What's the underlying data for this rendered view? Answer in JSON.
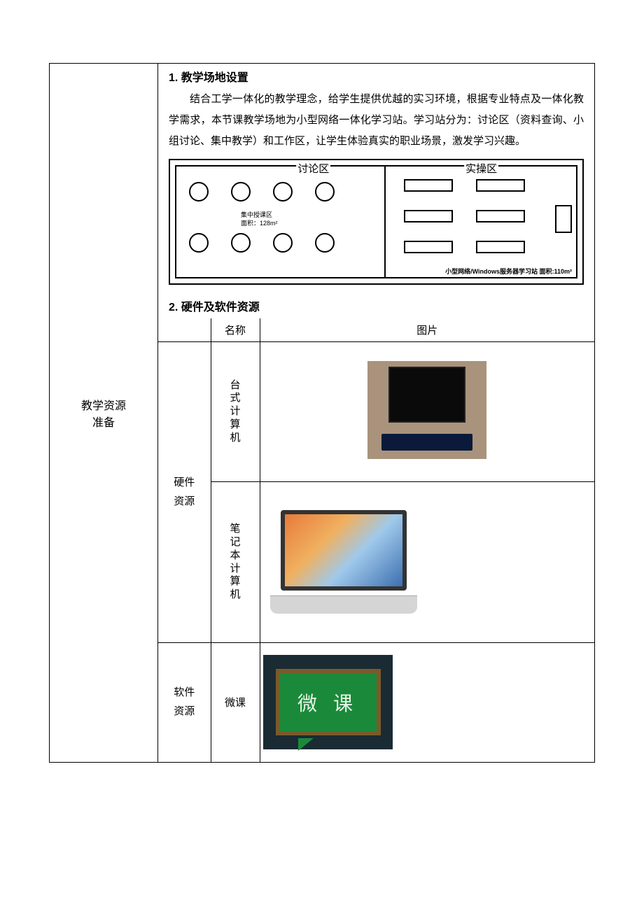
{
  "sidebar_label_line1": "教学资源",
  "sidebar_label_line2": "准备",
  "section1_heading": "1. 教学场地设置",
  "section1_body": "结合工学一体化的教学理念，给学生提供优越的实习环境，根据专业特点及一体化教学需求，本节课教学场地为小型网络一体化学习站。学习站分为：讨论区（资料查询、小组讨论、集中教学）和工作区，让学生体验真实的职业场景，激发学习兴趣。",
  "diagram": {
    "left_label": "讨论区",
    "right_label": "实操区",
    "center_caption_line1": "集中授课区",
    "center_caption_line2": "面积：128m²",
    "footer_text": "小型网络/Windows服务器学习站 面积:110m²"
  },
  "section2_heading": "2. 硬件及软件资源",
  "table_headers": {
    "name": "名称",
    "image": "图片"
  },
  "categories": {
    "hardware": "硬件资源",
    "software": "软件资源"
  },
  "rows": {
    "desktop_name": "台式计算机",
    "laptop_name": "笔记本计算机",
    "micro_name": "微课",
    "micro_board_text": "微 课"
  }
}
